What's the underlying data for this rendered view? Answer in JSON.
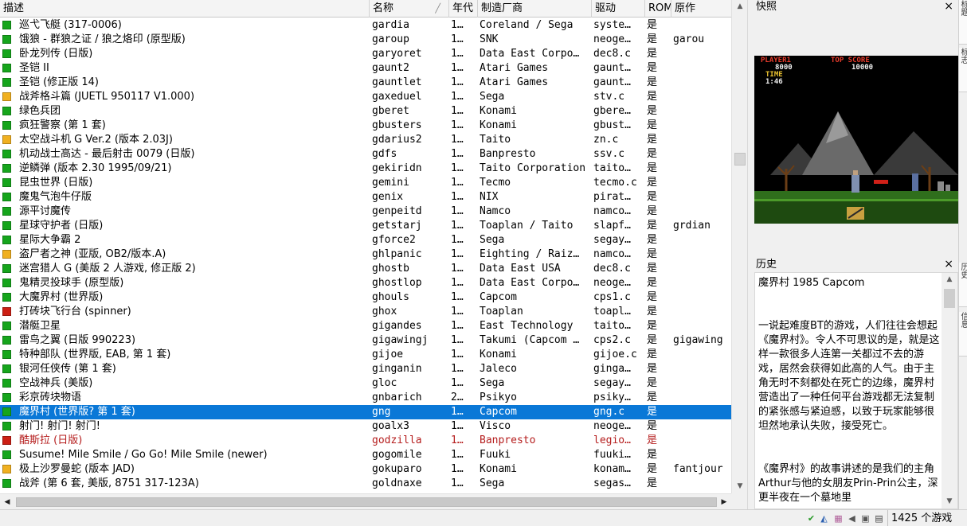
{
  "columns": {
    "desc": "描述",
    "name": "名称",
    "year": "年代",
    "maker": "制造厂商",
    "driver": "驱动",
    "rom": "ROM",
    "parent": "原作"
  },
  "colors": {
    "status_green": "#16a51c",
    "status_yellow": "#f0b020",
    "status_red": "#cc1f14",
    "selection": "#0a78d7"
  },
  "rows": [
    {
      "status": "green",
      "desc": "巡弋飞艇 (317-0006)",
      "name": "gardia",
      "year": "1…",
      "maker": "Coreland / Sega",
      "driver": "syste…",
      "rom": "是",
      "parent": ""
    },
    {
      "status": "green",
      "desc": "饿狼 - 群狼之证 / 狼之烙印 (原型版)",
      "name": "garoup",
      "year": "1…",
      "maker": "SNK",
      "driver": "neoge…",
      "rom": "是",
      "parent": "garou"
    },
    {
      "status": "green",
      "desc": "卧龙列传 (日版)",
      "name": "garyoret",
      "year": "1…",
      "maker": "Data East Corpo…",
      "driver": "dec8.c",
      "rom": "是",
      "parent": ""
    },
    {
      "status": "green",
      "desc": "圣铠 II",
      "name": "gaunt2",
      "year": "1…",
      "maker": "Atari Games",
      "driver": "gaunt…",
      "rom": "是",
      "parent": ""
    },
    {
      "status": "green",
      "desc": "圣铠 (修正版 14)",
      "name": "gauntlet",
      "year": "1…",
      "maker": "Atari Games",
      "driver": "gaunt…",
      "rom": "是",
      "parent": ""
    },
    {
      "status": "yellow",
      "desc": "战斧格斗篇 (JUETL 950117 V1.000)",
      "name": "gaxeduel",
      "year": "1…",
      "maker": "Sega",
      "driver": "stv.c",
      "rom": "是",
      "parent": ""
    },
    {
      "status": "green",
      "desc": "绿色兵团",
      "name": "gberet",
      "year": "1…",
      "maker": "Konami",
      "driver": "gbere…",
      "rom": "是",
      "parent": ""
    },
    {
      "status": "green",
      "desc": "疯狂警察 (第 1 套)",
      "name": "gbusters",
      "year": "1…",
      "maker": "Konami",
      "driver": "gbust…",
      "rom": "是",
      "parent": ""
    },
    {
      "status": "yellow",
      "desc": "太空战斗机 G Ver.2 (版本 2.03J)",
      "name": "gdarius2",
      "year": "1…",
      "maker": "Taito",
      "driver": "zn.c",
      "rom": "是",
      "parent": ""
    },
    {
      "status": "green",
      "desc": "机动战士高达 - 最后射击 0079 (日版)",
      "name": "gdfs",
      "year": "1…",
      "maker": "Banpresto",
      "driver": "ssv.c",
      "rom": "是",
      "parent": ""
    },
    {
      "status": "green",
      "desc": "逆鳞弹 (版本 2.30 1995/09/21)",
      "name": "gekiridn",
      "year": "1…",
      "maker": "Taito Corporation",
      "driver": "taito…",
      "rom": "是",
      "parent": ""
    },
    {
      "status": "green",
      "desc": "昆虫世界 (日版)",
      "name": "gemini",
      "year": "1…",
      "maker": "Tecmo",
      "driver": "tecmo.c",
      "rom": "是",
      "parent": ""
    },
    {
      "status": "green",
      "desc": "魔鬼气泡牛仔版",
      "name": "genix",
      "year": "1…",
      "maker": "NIX",
      "driver": "pirat…",
      "rom": "是",
      "parent": ""
    },
    {
      "status": "green",
      "desc": "源平讨魔传",
      "name": "genpeitd",
      "year": "1…",
      "maker": "Namco",
      "driver": "namco…",
      "rom": "是",
      "parent": ""
    },
    {
      "status": "green",
      "desc": "星球守护者 (日版)",
      "name": "getstarj",
      "year": "1…",
      "maker": "Toaplan / Taito",
      "driver": "slapf…",
      "rom": "是",
      "parent": "grdian"
    },
    {
      "status": "green",
      "desc": "星际大争霸 2",
      "name": "gforce2",
      "year": "1…",
      "maker": "Sega",
      "driver": "segay…",
      "rom": "是",
      "parent": ""
    },
    {
      "status": "yellow",
      "desc": "盗尸者之神 (亚版, OB2/版本.A)",
      "name": "ghlpanic",
      "year": "1…",
      "maker": "Eighting / Raiz…",
      "driver": "namco…",
      "rom": "是",
      "parent": ""
    },
    {
      "status": "green",
      "desc": "迷宫猎人 G (美版 2 人游戏, 修正版 2)",
      "name": "ghostb",
      "year": "1…",
      "maker": "Data East USA",
      "driver": "dec8.c",
      "rom": "是",
      "parent": ""
    },
    {
      "status": "green",
      "desc": "鬼精灵投球手 (原型版)",
      "name": "ghostlop",
      "year": "1…",
      "maker": "Data East Corpo…",
      "driver": "neoge…",
      "rom": "是",
      "parent": ""
    },
    {
      "status": "green",
      "desc": "大魔界村 (世界版)",
      "name": "ghouls",
      "year": "1…",
      "maker": "Capcom",
      "driver": "cps1.c",
      "rom": "是",
      "parent": ""
    },
    {
      "status": "red",
      "desc": "打砖块飞行台 (spinner)",
      "name": "ghox",
      "year": "1…",
      "maker": "Toaplan",
      "driver": "toapl…",
      "rom": "是",
      "parent": ""
    },
    {
      "status": "green",
      "desc": "潜艇卫星",
      "name": "gigandes",
      "year": "1…",
      "maker": "East Technology",
      "driver": "taito…",
      "rom": "是",
      "parent": ""
    },
    {
      "status": "green",
      "desc": "雷鸟之翼 (日版 990223)",
      "name": "gigawingj",
      "year": "1…",
      "maker": "Takumi (Capcom …",
      "driver": "cps2.c",
      "rom": "是",
      "parent": "gigawing"
    },
    {
      "status": "green",
      "desc": "特种部队 (世界版, EAB, 第 1 套)",
      "name": "gijoe",
      "year": "1…",
      "maker": "Konami",
      "driver": "gijoe.c",
      "rom": "是",
      "parent": ""
    },
    {
      "status": "green",
      "desc": "银河任侠传 (第 1 套)",
      "name": "ginganin",
      "year": "1…",
      "maker": "Jaleco",
      "driver": "ginga…",
      "rom": "是",
      "parent": ""
    },
    {
      "status": "green",
      "desc": "空战神兵 (美版)",
      "name": "gloc",
      "year": "1…",
      "maker": "Sega",
      "driver": "segay…",
      "rom": "是",
      "parent": ""
    },
    {
      "status": "green",
      "desc": "彩京砖块物语",
      "name": "gnbarich",
      "year": "2…",
      "maker": "Psikyo",
      "driver": "psiky…",
      "rom": "是",
      "parent": ""
    },
    {
      "status": "green",
      "desc": "魔界村 (世界版? 第 1 套)",
      "name": "gng",
      "year": "1…",
      "maker": "Capcom",
      "driver": "gng.c",
      "rom": "是",
      "parent": "",
      "selected": true
    },
    {
      "status": "green",
      "desc": "射门! 射门! 射门!",
      "name": "goalx3",
      "year": "1…",
      "maker": "Visco",
      "driver": "neoge…",
      "rom": "是",
      "parent": ""
    },
    {
      "status": "red",
      "desc": "酷斯拉 (日版)",
      "name": "godzilla",
      "year": "1…",
      "maker": "Banpresto",
      "driver": "legio…",
      "rom": "是",
      "parent": "",
      "warn": true
    },
    {
      "status": "green",
      "desc": "Susume! Mile Smile / Go Go! Mile Smile (newer)",
      "name": "gogomile",
      "year": "1…",
      "maker": "Fuuki",
      "driver": "fuuki…",
      "rom": "是",
      "parent": ""
    },
    {
      "status": "yellow",
      "desc": "极上沙罗曼蛇 (版本 JAD)",
      "name": "gokuparo",
      "year": "1…",
      "maker": "Konami",
      "driver": "konam…",
      "rom": "是",
      "parent": "fantjour"
    },
    {
      "status": "green",
      "desc": "战斧 (第 6 套, 美版, 8751 317-123A)",
      "name": "goldnaxe",
      "year": "1…",
      "maker": "Sega",
      "driver": "segas…",
      "rom": "是",
      "parent": ""
    }
  ],
  "snapshot_panel": {
    "title": "快照",
    "close": "×",
    "hud": {
      "player": "PLAYER1",
      "score": "8000",
      "top_label": "TOP SCORE",
      "top_score": "10000",
      "time_label": "TIME",
      "time_value": "1:46"
    }
  },
  "history_panel": {
    "title": "历史",
    "close": "×",
    "heading": "魔界村 1985 Capcom",
    "para1": "一说起难度BT的游戏，人们往往会想起《魔界村》。令人不可思议的是，就是这样一款很多人连第一关都过不去的游戏，居然会获得如此高的人气。由于主角无时不刻都处在死亡的边缘，魔界村营造出了一种任何平台游戏都无法复制的紧张感与紧迫感，以致于玩家能够很坦然地承认失败，接受死亡。",
    "para2": "《魔界村》的故事讲述的是我们的主角Arthur与他的女朋友Prin-Prin公主，深更半夜在一个墓地里"
  },
  "side_tabs": [
    "标题",
    "标志",
    "历史",
    "信息"
  ],
  "status_bar": {
    "count_text": "1425 个游戏"
  },
  "scroll": {
    "up": "▲",
    "down": "▼",
    "left": "◀",
    "right": "▶"
  }
}
